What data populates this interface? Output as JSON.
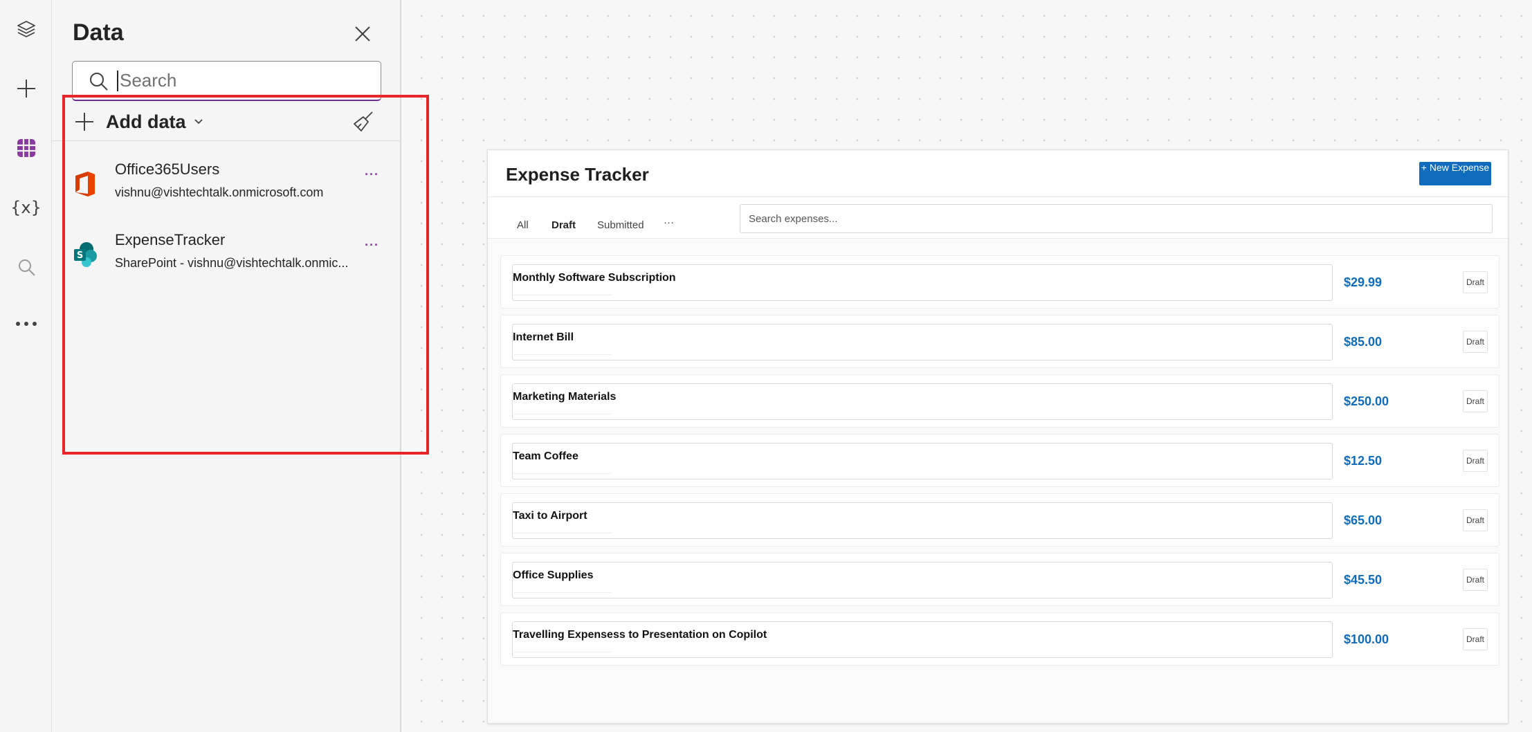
{
  "rail": {
    "items": [
      {
        "icon": "layers-icon"
      },
      {
        "icon": "plus-icon"
      },
      {
        "icon": "data-grid-icon",
        "active": true
      },
      {
        "icon": "variables-icon",
        "label": "{x}"
      },
      {
        "icon": "search-icon"
      },
      {
        "icon": "more-icon"
      }
    ],
    "active_color": "#8a3a9f"
  },
  "data_panel": {
    "title": "Data",
    "search": {
      "placeholder": "Search",
      "value": ""
    },
    "add_data_label": "Add data",
    "sources": [
      {
        "name": "Office365Users",
        "subtitle": "vishnu@vishtechtalk.onmicrosoft.com",
        "icon": "office365-icon",
        "more": "···"
      },
      {
        "name": "ExpenseTracker",
        "subtitle": "SharePoint - vishnu@vishtechtalk.onmic...",
        "icon": "sharepoint-icon",
        "more": "···"
      }
    ],
    "highlight_color": "#e8262a"
  },
  "app": {
    "title": "Expense Tracker",
    "new_button": "+ New Expense",
    "tabs": [
      {
        "label": "All",
        "active": false
      },
      {
        "label": "Draft",
        "active": true
      },
      {
        "label": "Submitted",
        "active": false
      },
      {
        "label": "···",
        "active": false
      }
    ],
    "search_placeholder": "Search expenses...",
    "expenses": [
      {
        "title": "Monthly Software Subscription",
        "amount": "$29.99",
        "status": "Draft"
      },
      {
        "title": "Internet Bill",
        "amount": "$85.00",
        "status": "Draft"
      },
      {
        "title": "Marketing Materials",
        "amount": "$250.00",
        "status": "Draft"
      },
      {
        "title": "Team Coffee",
        "amount": "$12.50",
        "status": "Draft"
      },
      {
        "title": "Taxi to Airport",
        "amount": "$65.00",
        "status": "Draft"
      },
      {
        "title": "Office Supplies",
        "amount": "$45.50",
        "status": "Draft"
      },
      {
        "title": "Travelling Expensess to Presentation on Copilot",
        "amount": "$100.00",
        "status": "Draft"
      }
    ],
    "accent_color": "#0f6cbd"
  }
}
